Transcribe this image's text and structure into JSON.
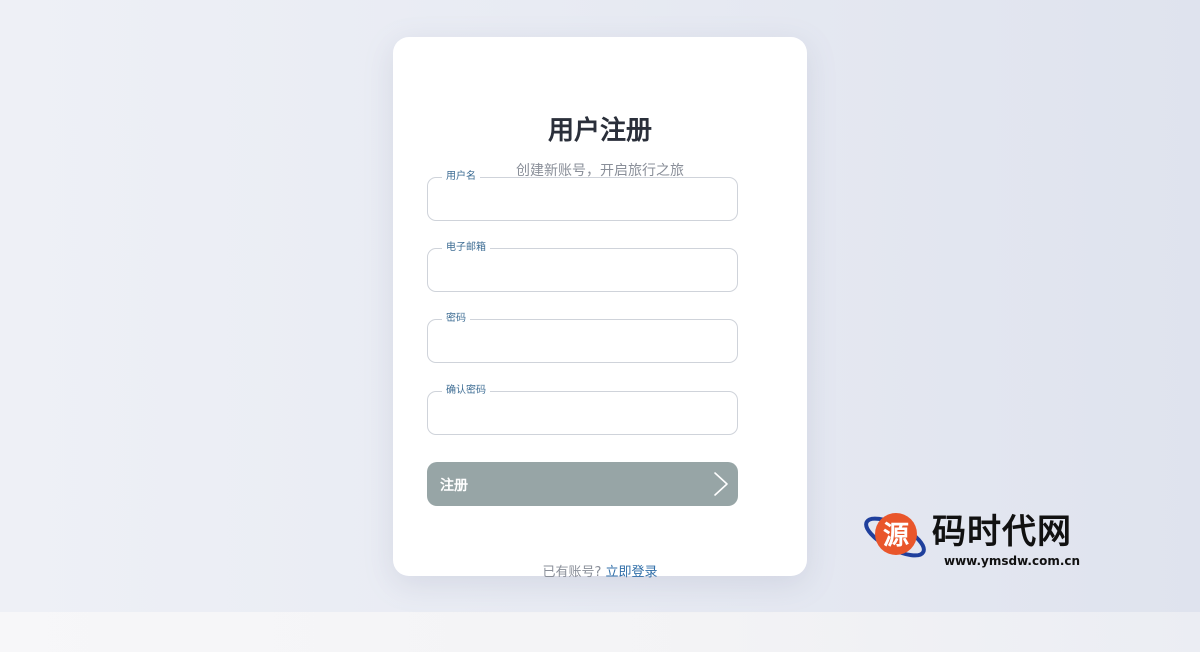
{
  "form": {
    "title": "用户注册",
    "subtitle": "创建新账号，开启旅行之旅",
    "fields": [
      {
        "label": "用户名",
        "value": "",
        "type": "text"
      },
      {
        "label": "电子邮箱",
        "value": "",
        "type": "email"
      },
      {
        "label": "密码",
        "value": "",
        "type": "password"
      },
      {
        "label": "确认密码",
        "value": "",
        "type": "password"
      }
    ],
    "submit_label": "注册",
    "login_prompt": "已有账号?",
    "login_link": "立即登录"
  },
  "watermark": {
    "glyph": "源",
    "name": "码时代网",
    "url": "www.ymsdw.com.cn"
  },
  "colors": {
    "accent": "#2f6ea8",
    "label": "#3e6d94",
    "button": "#97a5a6",
    "title": "#2a2f3a"
  },
  "icons": {
    "submit_arrow": "chevron-right-icon"
  }
}
